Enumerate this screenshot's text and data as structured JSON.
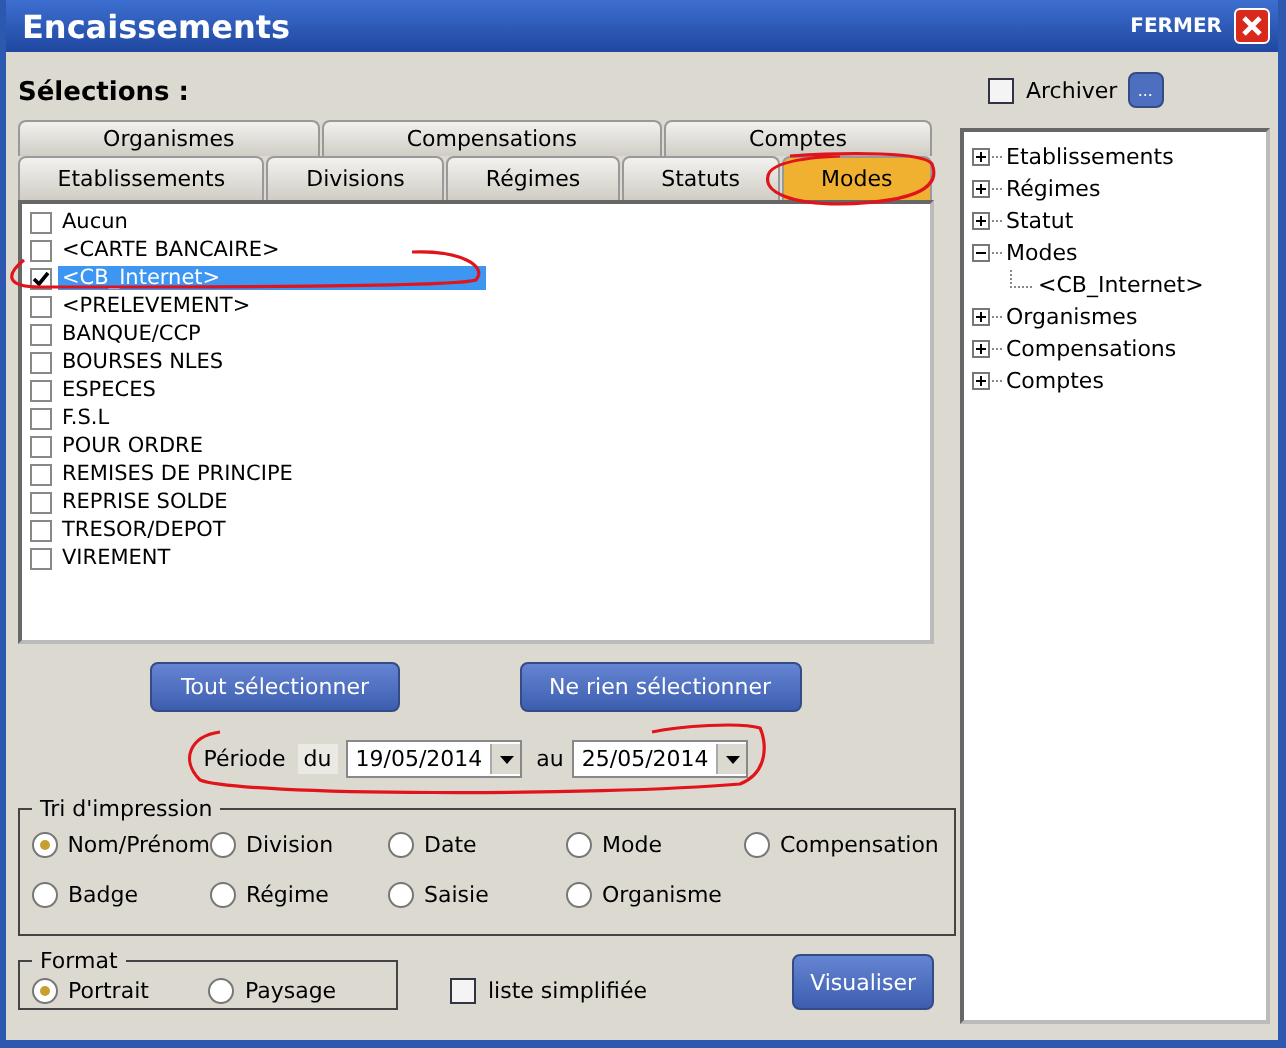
{
  "window": {
    "title": "Encaissements",
    "close_label": "FERMER"
  },
  "selections_label": "Sélections :",
  "tabs": [
    [
      {
        "label": "Organismes",
        "selected": false
      },
      {
        "label": "Compensations",
        "selected": false
      },
      {
        "label": "Comptes",
        "selected": false
      }
    ],
    [
      {
        "label": "Etablissements",
        "selected": false
      },
      {
        "label": "Divisions",
        "selected": false
      },
      {
        "label": "Régimes",
        "selected": false
      },
      {
        "label": "Statuts",
        "selected": false
      },
      {
        "label": "Modes",
        "selected": true
      }
    ]
  ],
  "items": [
    {
      "label": "Aucun",
      "checked": false,
      "selected": false
    },
    {
      "label": "<CARTE BANCAIRE>",
      "checked": false,
      "selected": false
    },
    {
      "label": "<CB_Internet>",
      "checked": true,
      "selected": true
    },
    {
      "label": "<PRELEVEMENT>",
      "checked": false,
      "selected": false
    },
    {
      "label": "BANQUE/CCP",
      "checked": false,
      "selected": false
    },
    {
      "label": "BOURSES NLES",
      "checked": false,
      "selected": false
    },
    {
      "label": "ESPECES",
      "checked": false,
      "selected": false
    },
    {
      "label": "F.S.L",
      "checked": false,
      "selected": false
    },
    {
      "label": "POUR ORDRE",
      "checked": false,
      "selected": false
    },
    {
      "label": "REMISES DE PRINCIPE",
      "checked": false,
      "selected": false
    },
    {
      "label": "REPRISE SOLDE",
      "checked": false,
      "selected": false
    },
    {
      "label": "TRESOR/DEPOT",
      "checked": false,
      "selected": false
    },
    {
      "label": "VIREMENT",
      "checked": false,
      "selected": false
    }
  ],
  "list_buttons": [
    "Tout sélectionner",
    "Ne rien sélectionner"
  ],
  "period": {
    "label": "Période",
    "from_label": "du",
    "from": "19/05/2014",
    "to_label": "au",
    "to": "25/05/2014"
  },
  "sort": {
    "title": "Tri d'impression",
    "options": [
      {
        "label": "Nom/Prénom",
        "selected": true
      },
      {
        "label": "Division",
        "selected": false
      },
      {
        "label": "Date",
        "selected": false
      },
      {
        "label": "Mode",
        "selected": false
      },
      {
        "label": "Compensation",
        "selected": false
      },
      {
        "label": "Badge",
        "selected": false
      },
      {
        "label": "Régime",
        "selected": false
      },
      {
        "label": "Saisie",
        "selected": false
      },
      {
        "label": "Organisme",
        "selected": false
      }
    ]
  },
  "format": {
    "title": "Format",
    "options": [
      {
        "label": "Portrait",
        "selected": true
      },
      {
        "label": "Paysage",
        "selected": false
      }
    ]
  },
  "simple_list": {
    "label": "liste simplifiée",
    "checked": false
  },
  "view_button": "Visualiser",
  "archive": {
    "label": "Archiver",
    "checked": false,
    "button": "..."
  },
  "tree": [
    {
      "label": "Etablissements",
      "expanded": false
    },
    {
      "label": "Régimes",
      "expanded": false
    },
    {
      "label": "Statut",
      "expanded": false
    },
    {
      "label": "Modes",
      "expanded": true,
      "children": [
        {
          "label": "<CB_Internet>"
        }
      ]
    },
    {
      "label": "Organismes",
      "expanded": false
    },
    {
      "label": "Compensations",
      "expanded": false
    },
    {
      "label": "Comptes",
      "expanded": false
    }
  ]
}
